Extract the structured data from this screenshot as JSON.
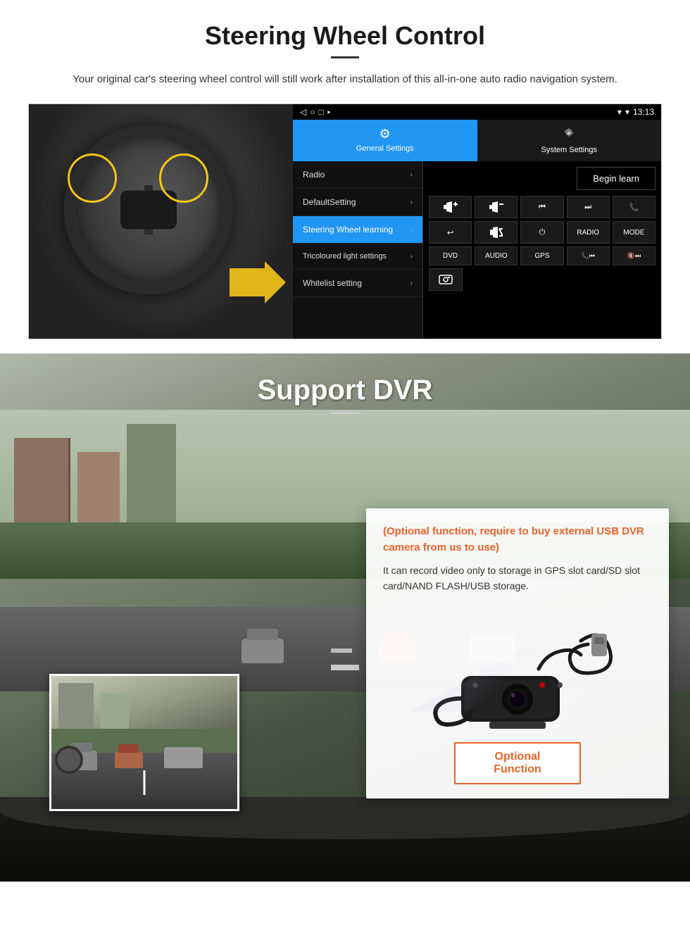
{
  "page": {
    "steering": {
      "title": "Steering Wheel Control",
      "subtitle": "Your original car's steering wheel control will still work after installation of this all-in-one auto radio navigation system.",
      "android_ui": {
        "status_bar": {
          "time": "13:13",
          "signal_icon": "▼",
          "wifi_icon": "▾"
        },
        "tabs": [
          {
            "label": "General Settings",
            "icon": "⚙",
            "active": true
          },
          {
            "label": "System Settings",
            "icon": "⚙",
            "active": false
          }
        ],
        "menu_items": [
          {
            "label": "Radio",
            "selected": false
          },
          {
            "label": "DefaultSetting",
            "selected": false
          },
          {
            "label": "Steering Wheel learning",
            "selected": true
          },
          {
            "label": "Tricoloured light settings",
            "selected": false
          },
          {
            "label": "Whitelist setting",
            "selected": false
          }
        ],
        "begin_learn_label": "Begin learn",
        "control_buttons": [
          [
            "⏮+",
            "⏮–",
            "⏮|",
            "|⏭",
            "📞"
          ],
          [
            "↩",
            "🔇",
            "⏻",
            "RADIO",
            "MODE"
          ],
          [
            "DVD",
            "AUDIO",
            "GPS",
            "📞⏮|",
            "🔇⏭"
          ]
        ]
      }
    },
    "dvr": {
      "title": "Support DVR",
      "optional_text": "(Optional function, require to buy external USB DVR camera from us to use)",
      "description": "It can record video only to storage in GPS slot card/SD slot card/NAND FLASH/USB storage.",
      "optional_function_label": "Optional Function"
    }
  }
}
